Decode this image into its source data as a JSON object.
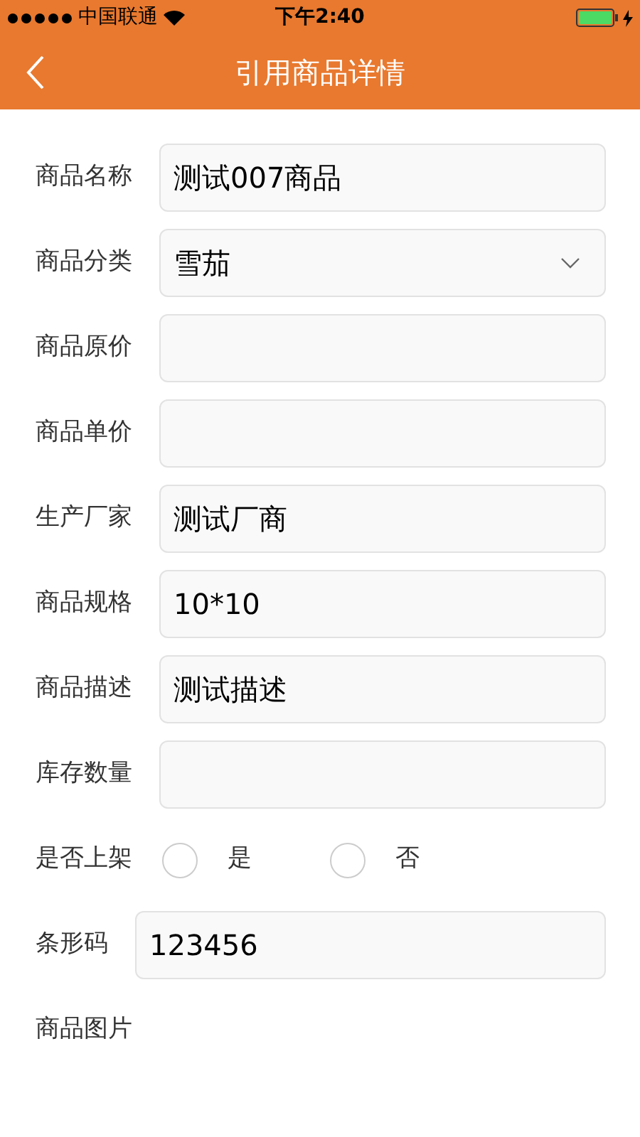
{
  "status_bar": {
    "carrier": "中国联通",
    "time": "下午2:40"
  },
  "nav": {
    "title": "引用商品详情"
  },
  "fields": [
    {
      "kind": "text",
      "label": "商品名称",
      "value": "测试007商品"
    },
    {
      "kind": "select",
      "label": "商品分类",
      "value": "雪茄"
    },
    {
      "kind": "text",
      "label": "商品原价"
    },
    {
      "kind": "text",
      "label": "商品单价"
    },
    {
      "kind": "text",
      "label": "生产厂家",
      "value": "测试厂商"
    },
    {
      "kind": "text",
      "label": "商品规格",
      "value": "10*10"
    },
    {
      "kind": "text",
      "label": "商品描述",
      "value": "测试描述"
    },
    {
      "kind": "text",
      "label": "库存数量"
    },
    {
      "kind": "radio",
      "label": "是否上架",
      "options": [
        {
          "label": "是",
          "selected": false
        },
        {
          "label": "否",
          "selected": false
        }
      ]
    },
    {
      "kind": "short",
      "label": "条形码",
      "value": "123456"
    },
    {
      "kind": "image",
      "label": "商品图片"
    }
  ]
}
